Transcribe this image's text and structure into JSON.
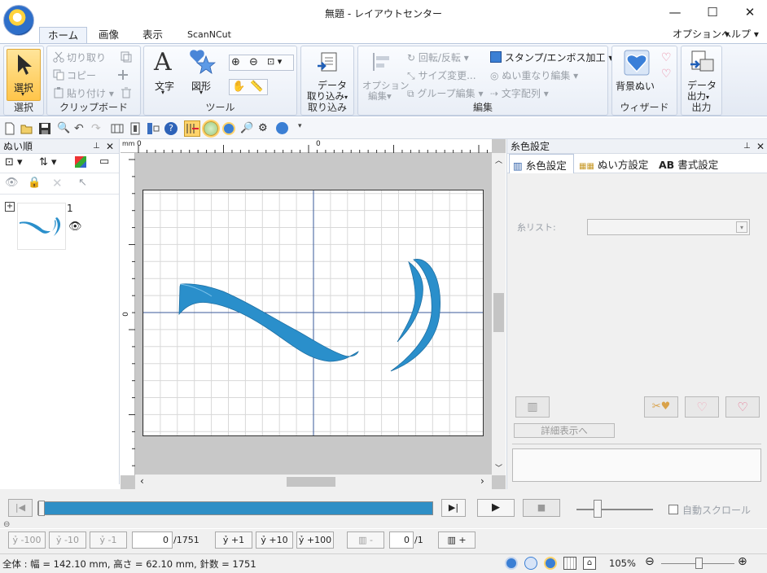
{
  "window": {
    "title": "無題 - レイアウトセンター",
    "minimize": "—",
    "maximize": "☐",
    "close": "✕"
  },
  "tabs": [
    {
      "label": "ホーム"
    },
    {
      "label": "画像"
    },
    {
      "label": "表示"
    },
    {
      "label": "ScanNCut"
    }
  ],
  "menu_right": {
    "options": "オプション",
    "help": "ヘルプ"
  },
  "ribbon": {
    "select": {
      "button": "選択",
      "group": "選択"
    },
    "clipboard": {
      "cut": "切り取り",
      "copy": "コピー",
      "paste": "貼り付け",
      "group": "クリップボード"
    },
    "tools": {
      "text": "文字",
      "shape": "図形",
      "group": "ツール"
    },
    "import": {
      "button_line1": "データ",
      "button_line2": "取り込み",
      "group": "取り込み"
    },
    "edit": {
      "option_line1": "オプション",
      "option_line2": "編集",
      "rotate": "回転/反転",
      "resize": "サイズ変更...",
      "group_edit": "グループ編集",
      "stamp": "スタンプ/エンボス加工",
      "overlap": "ぬい重なり編集",
      "text_array": "文字配列",
      "group": "編集"
    },
    "wizard": {
      "button": "背景ぬい",
      "group": "ウィザード"
    },
    "output": {
      "button_line1": "データ",
      "button_line2": "出力",
      "group": "出力"
    }
  },
  "left_panel": {
    "title": "ぬい順",
    "pin": "ꟸ",
    "close": "✕",
    "item_number": "1"
  },
  "right_panel": {
    "title": "糸色設定",
    "tabs": [
      {
        "label": "糸色設定"
      },
      {
        "label": "ぬい方設定"
      },
      {
        "label": "書式設定"
      }
    ],
    "format_prefix": "AB",
    "thread_list_label": "糸リスト:",
    "details_button": "詳細表示へ"
  },
  "ruler": {
    "unit": "mm",
    "zero_top": "0",
    "zero_origin": "0",
    "zero_left": "0"
  },
  "transport": {
    "auto_scroll": "自動スクロール"
  },
  "steps": {
    "minus100": "-100",
    "minus10": "-10",
    "minus1": "-1",
    "current": "0",
    "total": "/1751",
    "plus1": "+1",
    "plus10": "+10",
    "plus100": "+100",
    "minus": "-",
    "group_current": "0",
    "group_total": "/1",
    "plus": "+"
  },
  "status": {
    "summary": "全体 : 幅 = 142.10 mm, 高さ = 62.10 mm, 針数 = 1751",
    "zoom": "105%"
  },
  "colors": {
    "accent": "#2f8fc6",
    "stitch": "#2a8fcb",
    "ribbon_bg": "#e3e9f3",
    "progress": "#2f8fc6"
  },
  "progress": {
    "fraction": 1.0
  }
}
